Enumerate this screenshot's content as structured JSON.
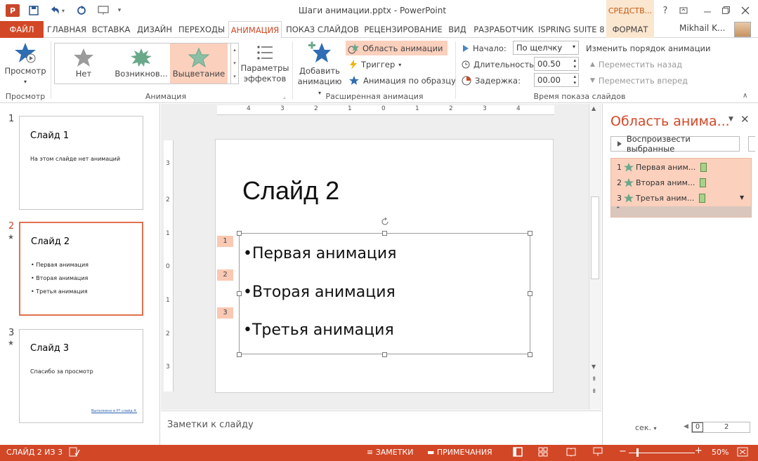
{
  "app": {
    "title": "Шаги анимации.pptx - PowerPoint",
    "contextual_header": "СРЕДСТВ...",
    "user": "Mikhail K...",
    "help": "?"
  },
  "tabs": {
    "file": "ФАЙЛ",
    "home": "ГЛАВНАЯ",
    "insert": "ВСТАВКА",
    "design": "ДИЗАЙН",
    "transitions": "ПЕРЕХОДЫ",
    "animation": "АНИМАЦИЯ",
    "slideshow": "ПОКАЗ СЛАЙДОВ",
    "review": "РЕЦЕНЗИРОВАНИЕ",
    "view": "ВИД",
    "developer": "РАЗРАБОТЧИК",
    "ispring": "ISPRING SUITE 8",
    "format": "ФОРМАТ"
  },
  "ribbon": {
    "preview": {
      "label": "Просмотр",
      "group": "Просмотр"
    },
    "animation_group": {
      "label": "Анимация",
      "items": [
        "Нет",
        "Возникнов...",
        "Выцветание"
      ],
      "selected_index": 2
    },
    "effect_options": {
      "line1": "Параметры",
      "line2": "эффектов"
    },
    "advanced": {
      "group": "Расширенная анимация",
      "add_line1": "Добавить",
      "add_line2": "анимацию",
      "pane": "Область анимации",
      "trigger": "Триггер",
      "painter": "Анимация по образцу"
    },
    "timing": {
      "group": "Время показа слайдов",
      "start_label": "Начало:",
      "start_value": "По щелчку",
      "duration_label": "Длительность:",
      "duration_value": "00.50",
      "delay_label": "Задержка:",
      "delay_value": "00.00",
      "reorder": "Изменить порядок анимации",
      "move_earlier": "Переместить назад",
      "move_later": "Переместить вперед"
    }
  },
  "thumbnails": [
    {
      "num": "1",
      "title": "Слайд 1",
      "lines": [
        "На этом слайде нет анимаций"
      ]
    },
    {
      "num": "2",
      "title": "Слайд 2",
      "lines": [
        "• Первая анимация",
        "• Вторая анимация",
        "• Третья анимация"
      ]
    },
    {
      "num": "3",
      "title": "Слайд 3",
      "lines": [
        "Спасибо за просмотр"
      ],
      "footer": "Выполнено в Р? слайд 4."
    }
  ],
  "slide": {
    "title": "Слайд 2",
    "bullets": [
      "•Первая анимация",
      "•Вторая анимация",
      "•Третья анимация"
    ],
    "tags": [
      "1",
      "2",
      "3"
    ]
  },
  "ruler": {
    "h": [
      "4",
      "3",
      "2",
      "1",
      "0",
      "1",
      "2",
      "3",
      "4"
    ],
    "v": [
      "3",
      "2",
      "1",
      "0",
      "1",
      "2",
      "3"
    ]
  },
  "notes_placeholder": "Заметки к слайду",
  "pane": {
    "title": "Область анима...",
    "play": "Воспроизвести выбранные",
    "items": [
      {
        "num": "1",
        "label": "Первая аним..."
      },
      {
        "num": "2",
        "label": "Вторая аним..."
      },
      {
        "num": "3",
        "label": "Третья аним..."
      }
    ],
    "sec": "сек.",
    "timeline_start": "0",
    "timeline_end": "2"
  },
  "status": {
    "slide": "СЛАЙД 2 ИЗ 3",
    "notes": "ЗАМЕТКИ",
    "comments": "ПРИМЕЧАНИЯ",
    "zoom": "50%"
  },
  "colors": {
    "accent": "#d24726",
    "selection": "#fbd0bd",
    "star_green": "#6aa88a",
    "star_blue": "#2e6db4"
  }
}
